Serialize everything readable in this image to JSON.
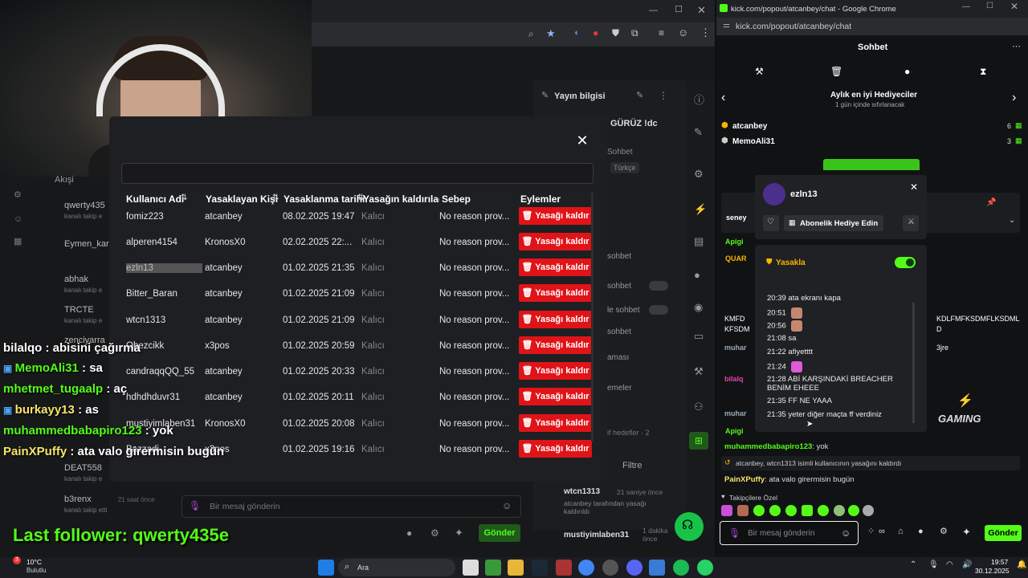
{
  "left_browser": {
    "sidebar_label": "Akışi"
  },
  "followers": [
    {
      "name": "qwerty435",
      "sub": "kanalı takip e"
    },
    {
      "name": "Eymen_kar",
      "sub": ""
    },
    {
      "name": "abhak",
      "sub": "kanalı takip e"
    },
    {
      "name": "TRCTE",
      "sub": "kanalı takip e"
    },
    {
      "name": "zenciyarra",
      "sub": ""
    },
    {
      "name": "DEAT558",
      "sub": "kanalı takip e"
    },
    {
      "name": "b3renx",
      "sub": "kanalı takip etti",
      "time": "21 saat önce"
    }
  ],
  "stream_info": {
    "title": "Yayın bilgisi",
    "stream_title": "GÜRÜZ !dc",
    "category_label": "Sohbet",
    "language": "Türkçe"
  },
  "dashboard": {
    "sohbet1": "sohbet",
    "sohbet2": "sohbet",
    "sohbet3": "le sohbet",
    "sohbet4": "sohbet",
    "amasi": "aması",
    "emeler": "emeler",
    "hedefler": "if hedefler · 2",
    "filter": "Filtre",
    "msg_placeholder": "Bir mesaj gönderin",
    "send": "Gönder",
    "activity1_name": "wtcn1313",
    "activity1_time": "21 saniye önce",
    "activity1_desc": "atcanbey tarafından yasağı kaldırıldı",
    "activity2_name": "mustiyimlaben31",
    "activity2_time": "1 dakika önce"
  },
  "modal": {
    "columns": [
      "Kullanıcı Adı",
      "Yasaklayan Kişi",
      "Yasaklanma tarihi",
      "Yasağın kaldırılaca",
      "Sebep",
      "Eylemler"
    ],
    "unban_label": "Yasağı kaldır",
    "rows": [
      {
        "user": "fomiz223",
        "by": "atcanbey",
        "date": "08.02.2025 19:47",
        "until": "Kalıcı",
        "reason": "No reason prov..."
      },
      {
        "user": "alperen4154",
        "by": "KronosX0",
        "date": "02.02.2025 22:...",
        "until": "Kalıcı",
        "reason": "No reason prov..."
      },
      {
        "user": "ezln13",
        "by": "atcanbey",
        "date": "01.02.2025 21:35",
        "until": "Kalıcı",
        "reason": "No reason prov..."
      },
      {
        "user": "Bitter_Baran",
        "by": "atcanbey",
        "date": "01.02.2025 21:09",
        "until": "Kalıcı",
        "reason": "No reason prov..."
      },
      {
        "user": "wtcn1313",
        "by": "atcanbey",
        "date": "01.02.2025 21:09",
        "until": "Kalıcı",
        "reason": "No reason prov..."
      },
      {
        "user": "Obezcikk",
        "by": "x3pos",
        "date": "01.02.2025 20:59",
        "until": "Kalıcı",
        "reason": "No reason prov..."
      },
      {
        "user": "candraqqQQ_55",
        "by": "atcanbey",
        "date": "01.02.2025 20:33",
        "until": "Kalıcı",
        "reason": "No reason prov..."
      },
      {
        "user": "hdhdhduvr31",
        "by": "atcanbey",
        "date": "01.02.2025 20:11",
        "until": "Kalıcı",
        "reason": "No reason prov..."
      },
      {
        "user": "mustiyimlaben31",
        "by": "KronosX0",
        "date": "01.02.2025 20:08",
        "until": "Kalıcı",
        "reason": "No reason prov..."
      },
      {
        "user": "Bazzadi",
        "by": "x3pos",
        "date": "01.02.2025 19:16",
        "until": "Kalıcı",
        "reason": "No reason prov..."
      }
    ]
  },
  "overlay_chat": [
    {
      "user": "bilalqo",
      "text": ": abisini çağırma"
    },
    {
      "user": "MemoAli31",
      "text": ": sa"
    },
    {
      "user": "mhetmet_tugaalp",
      "text": ": aç"
    },
    {
      "user": "burkayy13",
      "text": ": as"
    },
    {
      "user": "muhammedbabapiro123",
      "text": ": yok"
    },
    {
      "user": "PainXPuffy",
      "text": ": ata valo girermisin bugün"
    }
  ],
  "last_follower": "Last follower: qwerty435e",
  "right_chrome": {
    "title": "kick.com/popout/atcanbey/chat - Google Chrome",
    "url": "kick.com/popout/atcanbey/chat"
  },
  "chat": {
    "header": "Sohbet",
    "gifters_title": "Aylık en iyi Hediyeciler",
    "gifters_sub": "1 gün içinde sıfırlanacak",
    "gifters": [
      {
        "name": "atcanbey",
        "count": "6"
      },
      {
        "name": "MemoAli31",
        "count": "3"
      }
    ],
    "partial": [
      "seney",
      "Apigi",
      "QUAR",
      "KMFD",
      "KFSDM",
      "muhar",
      "bilalq",
      "muhar",
      "Apigi"
    ],
    "partial_right": [
      "KDLFMFKSDMFLKSDML",
      "D",
      "3jre"
    ],
    "msg1_user": "muhammedbabapiro123",
    "msg1_text": "yok",
    "system_msg": "atcanbey, wtcn1313 isimli kullanıcının yasağını kaldırdı",
    "msg2_user": "PainXPuffy",
    "msg2_text": "ata valo girermisin bugün",
    "emote_label": "Takipçilere Özel",
    "input_placeholder": "Bir mesaj gönderin",
    "send": "Gönder"
  },
  "user_popup": {
    "username": "ezln13",
    "gift_sub": "Abonelik Hediye Edin",
    "ban_label": "Yasakla",
    "log": [
      {
        "t": "20:39",
        "msg": "ata ekranı kapa"
      },
      {
        "t": "20:51",
        "msg": ""
      },
      {
        "t": "20:56",
        "msg": ""
      },
      {
        "t": "21:08",
        "msg": "sa"
      },
      {
        "t": "21:22",
        "msg": "afiyetttt"
      },
      {
        "t": "21:24",
        "msg": ""
      },
      {
        "t": "21:28",
        "msg": "ABİ KARŞINDAKİ BREACHER BENİM EHEEE"
      },
      {
        "t": "21:35",
        "msg": "FF NE YAAA"
      },
      {
        "t": "21:35",
        "msg": "yeter diğer maçta ff verdiniz"
      }
    ]
  },
  "watermark": "GAMING",
  "taskbar": {
    "weather_temp": "10°C",
    "weather_desc": "Bulutlu",
    "search": "Ara",
    "time": "19:57",
    "date": "30.12.2025",
    "badge": "3"
  },
  "colors": {
    "kick_green": "#53fc18",
    "unban_red": "#e01418",
    "overlay_green": "#53fc18"
  }
}
